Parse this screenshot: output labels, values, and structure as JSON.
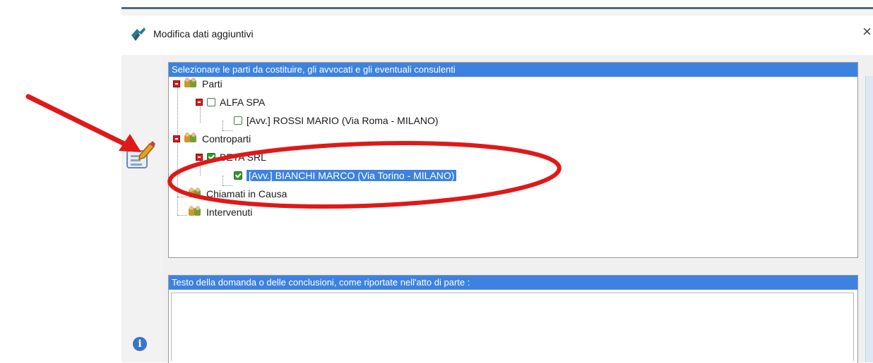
{
  "window": {
    "title": "Modifica dati aggiuntivi",
    "close_label": "×"
  },
  "parties_panel": {
    "header": "Selezionare le parti da costituire, gli avvocati e gli eventuali consulenti",
    "tree": {
      "parti": {
        "label": "Parti",
        "alfa": "ALFA SPA",
        "rossi": "[Avv.] ROSSI MARIO (Via Roma - MILANO)"
      },
      "controparti": {
        "label": "Controparti",
        "beta": "BETA SRL",
        "bianchi": "[Avv.] BIANCHI MARCO (Via Torino - MILANO)"
      },
      "chiamati": "Chiamati in Causa",
      "intervenuti": "Intervenuti"
    }
  },
  "conclusions_panel": {
    "header": "Testo della domanda o delle conclusioni, come riportate nell'atto di parte :",
    "value": ""
  },
  "colors": {
    "header_blue": "#3d82e0",
    "annotation_red": "#e01818"
  }
}
